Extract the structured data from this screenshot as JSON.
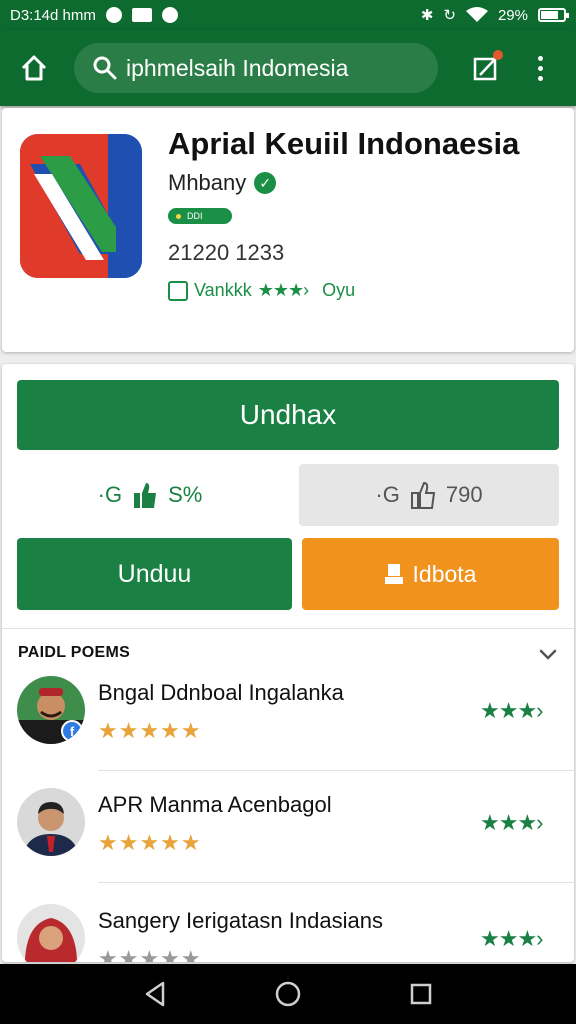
{
  "status_bar": {
    "time": "D3:14d hmm",
    "battery": "29%"
  },
  "search": {
    "query": "iphmelsaih  Indomesia"
  },
  "app": {
    "title": "Aprial Keuiil Indonaesia",
    "developer": "Mhbany",
    "tag": "DDI",
    "downloads": "21220 1233",
    "rating_text": "Vankkk",
    "rating_stars": "★★★›",
    "rating_extra": "Oyu"
  },
  "actions": {
    "install": "Undhax",
    "upvote_prefix": "·G",
    "upvote_value": "S%",
    "downvote_prefix": "·G",
    "downvote_value": "790",
    "secondary_left": "Unduu",
    "secondary_right": "Idbota"
  },
  "reviews_section": {
    "title": "PAIDL POEMS",
    "items": [
      {
        "name": "Bngal Ddnboal Ingalanka",
        "user_stars": "★★★★★",
        "rating_stars": "★★★›"
      },
      {
        "name": "APR Manma Acenbagol",
        "user_stars": "★★★★★",
        "rating_stars": "★★★›"
      },
      {
        "name": "Sangery Ierigatasn Indasians",
        "user_stars": "★★★★★",
        "rating_stars": "★★★›"
      }
    ]
  },
  "colors": {
    "primary": "#0d6b30",
    "button_green": "#1a8043",
    "accent_orange": "#f0921c",
    "star_gold": "#e8a33a"
  }
}
